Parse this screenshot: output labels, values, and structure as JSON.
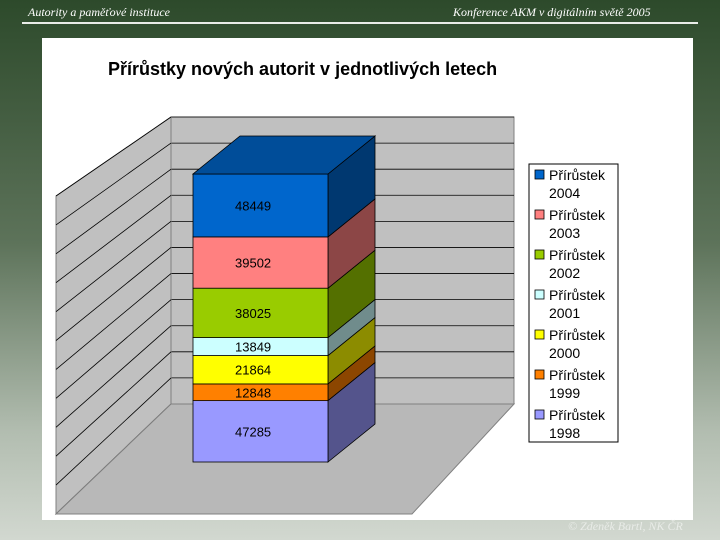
{
  "header": {
    "left": "Autority a paměťové instituce",
    "right": "Konference AKM v digitálním světě 2005"
  },
  "footer": "© Zdeněk Bartl, NK ČR",
  "chart_data": {
    "type": "bar",
    "variant": "3d-stacked-column",
    "title": "Přírůstky nových autorit v jednotlivých letech",
    "legend_position": "right",
    "grid": true,
    "series": [
      {
        "name": "Přírůstek 1998",
        "value": 47285,
        "color": "#9999ff"
      },
      {
        "name": "Přírůstek 1999",
        "value": 12848,
        "color": "#ff8000"
      },
      {
        "name": "Přírůstek 2000",
        "value": 21864,
        "color": "#ffff00"
      },
      {
        "name": "Přírůstek 2001",
        "value": 13849,
        "color": "#ccffff"
      },
      {
        "name": "Přírůstek 2002",
        "value": 38025,
        "color": "#99cc00"
      },
      {
        "name": "Přírůstek 2003",
        "value": 39502,
        "color": "#ff8080"
      },
      {
        "name": "Přírůstek 2004",
        "value": 48449,
        "color": "#0066cc"
      }
    ]
  }
}
